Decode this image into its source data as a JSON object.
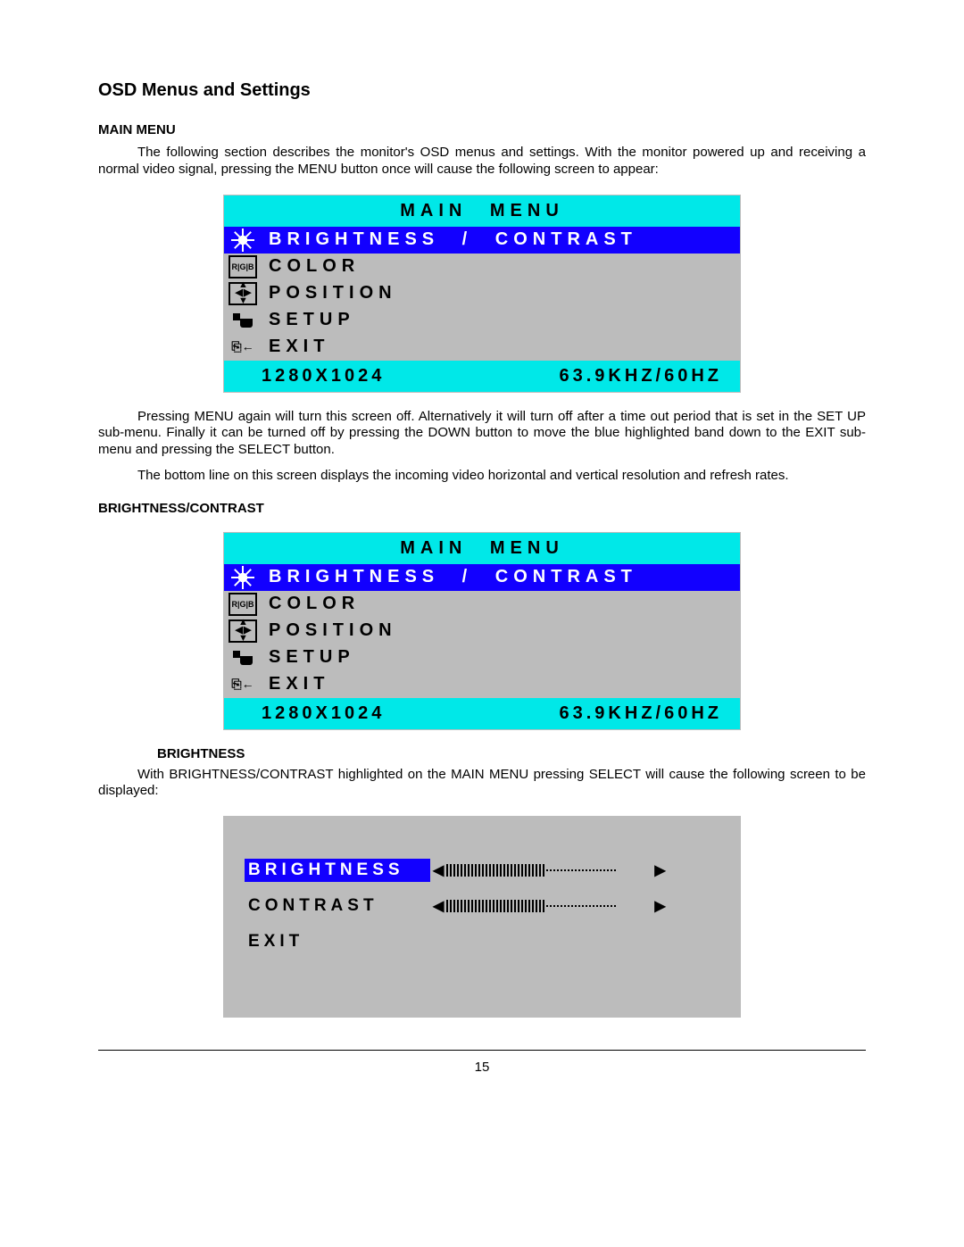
{
  "headings": {
    "title": "OSD Menus and Settings",
    "main_menu": "MAIN MENU",
    "brightness_contrast": "BRIGHTNESS/CONTRAST",
    "brightness": "BRIGHTNESS"
  },
  "paragraphs": {
    "p1": "The following section describes the monitor's OSD menus and settings. With the monitor powered up and receiving a normal video signal, pressing the MENU button once will cause the following screen to appear:",
    "p2": "Pressing MENU again will turn this screen off. Alternatively it will turn off after a time out period that is set in the SET UP sub-menu. Finally it can be turned off by pressing the DOWN button to move the blue highlighted band down to the EXIT sub-menu and pressing the SELECT button.",
    "p3": "The bottom line on this screen displays the incoming video horizontal and vertical resolution and refresh rates.",
    "p4": "With BRIGHTNESS/CONTRAST highlighted on the MAIN MENU pressing SELECT will cause the following screen to be displayed:"
  },
  "osd": {
    "title": "MAIN MENU",
    "items": [
      {
        "label": "BRIGHTNESS / CONTRAST",
        "selected": true,
        "icon": "sun"
      },
      {
        "label": "COLOR",
        "selected": false,
        "icon": "rgb"
      },
      {
        "label": "POSITION",
        "selected": false,
        "icon": "arrows"
      },
      {
        "label": "SETUP",
        "selected": false,
        "icon": "setup"
      },
      {
        "label": "EXIT",
        "selected": false,
        "icon": "exit"
      }
    ],
    "footer_left": "1280X1024",
    "footer_right": "63.9KHZ/60HZ"
  },
  "slider": {
    "rows": [
      {
        "label": "BRIGHTNESS",
        "selected": true,
        "fill": 58
      },
      {
        "label": "CONTRAST",
        "selected": false,
        "fill": 58
      },
      {
        "label": "EXIT",
        "selected": false,
        "fill": null
      }
    ]
  },
  "page_number": "15"
}
